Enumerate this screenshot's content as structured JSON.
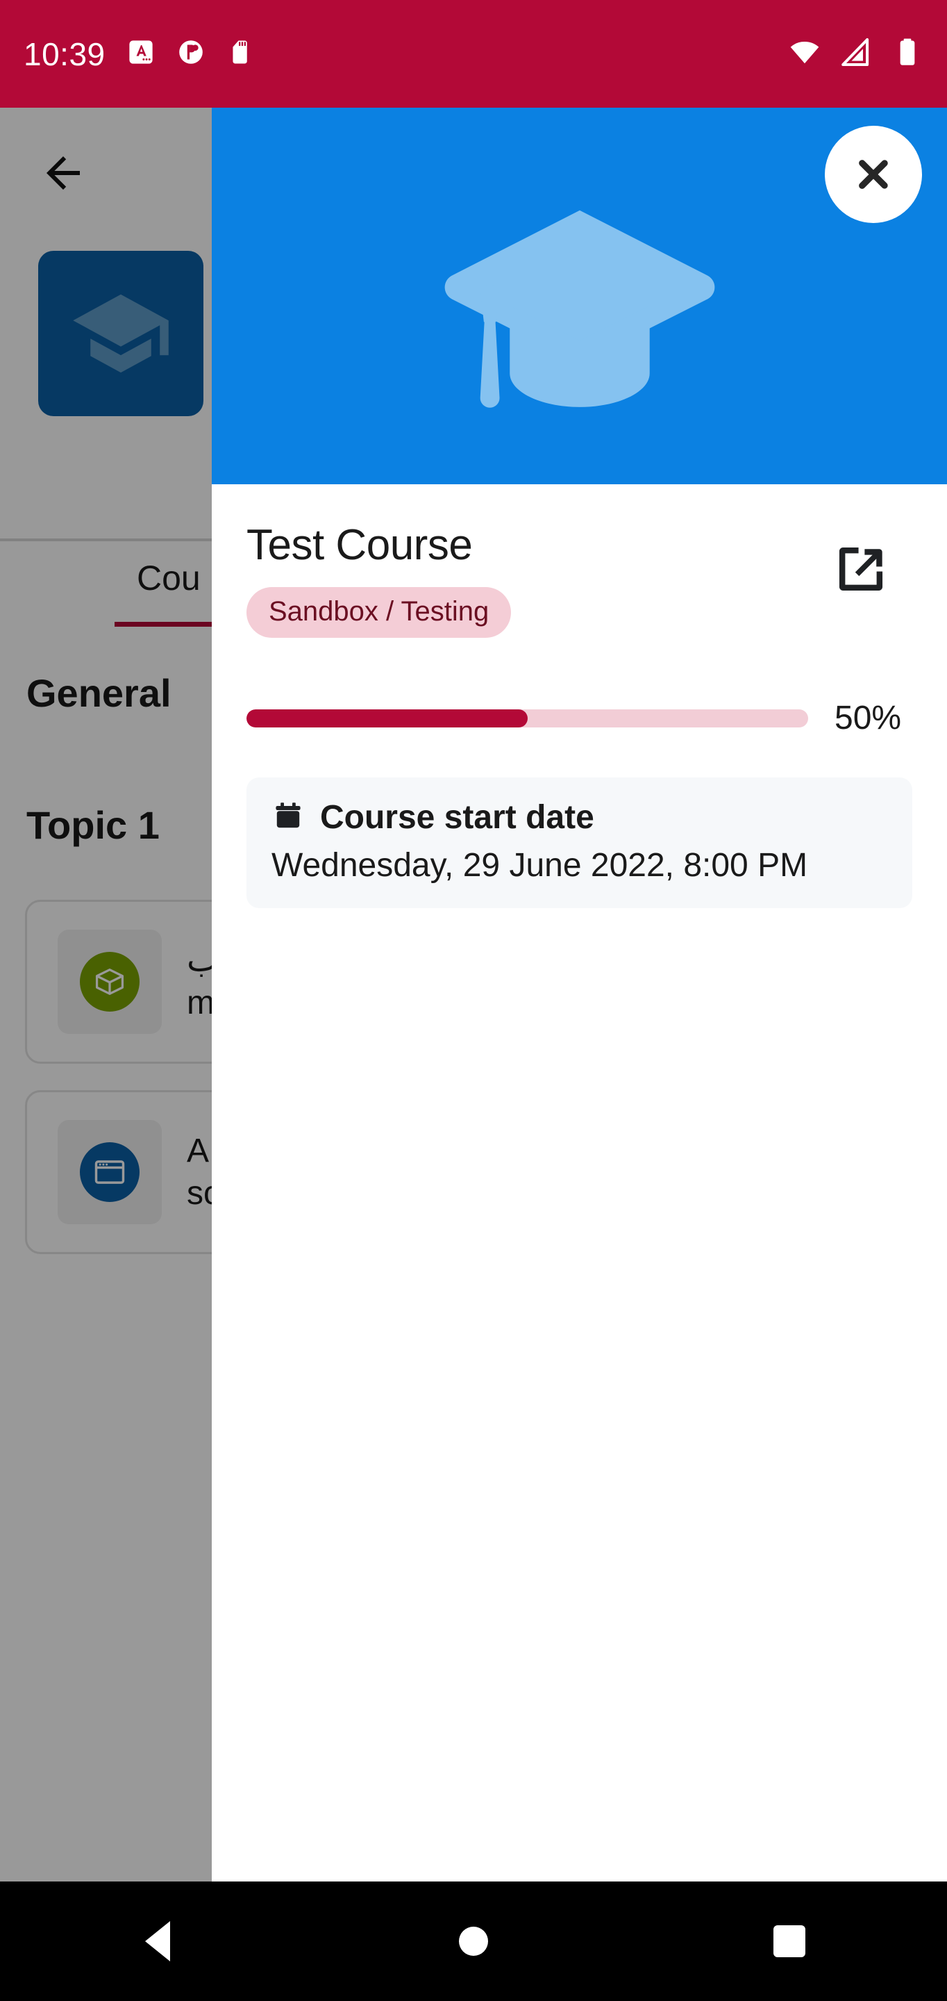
{
  "status_bar": {
    "clock": "10:39",
    "background_color": "#b30937",
    "left_icons": [
      {
        "name": "keyboard-language-icon",
        "glyph": "A"
      },
      {
        "name": "do-not-disturb-icon",
        "glyph": "circle"
      },
      {
        "name": "sd-card-icon",
        "glyph": "sd"
      }
    ],
    "right_icons": [
      {
        "name": "wifi-icon",
        "glyph": "wifi"
      },
      {
        "name": "cellular-signal-icon",
        "glyph": "signal"
      },
      {
        "name": "battery-icon",
        "glyph": "battery"
      }
    ]
  },
  "background_app": {
    "back_label": "Back",
    "tab_label": "Cou",
    "sections": [
      {
        "title": "General"
      },
      {
        "title": "Topic 1"
      }
    ],
    "activities": [
      {
        "icon": "scorm-package-icon",
        "icon_color": "#7aa203",
        "line1": "ةب",
        "line2": "m"
      },
      {
        "icon": "url-resource-icon",
        "icon_color": "#0b5fa5",
        "line1": "A",
        "line2": "sc"
      }
    ],
    "accent_color": "#b30937",
    "thumb_color": "#0b5fa5"
  },
  "modal": {
    "header_color": "#0b81e2",
    "hero_icon": "graduation-cap-icon",
    "close_label": "Close",
    "title": "Test Course",
    "open_in_browser_label": "Open in browser",
    "badge": {
      "text": "Sandbox / Testing",
      "background_color": "#f4cdd6",
      "text_color": "#6b0f22"
    },
    "progress": {
      "percent": 50,
      "label": "50%",
      "fill_color": "#b30937",
      "track_color": "#f2cdd6"
    },
    "date_card": {
      "icon": "calendar-icon",
      "title": "Course start date",
      "value": "Wednesday, 29 June 2022, 8:00 PM"
    }
  },
  "nav_bar": {
    "back_label": "Back",
    "home_label": "Home",
    "recents_label": "Recent apps"
  }
}
